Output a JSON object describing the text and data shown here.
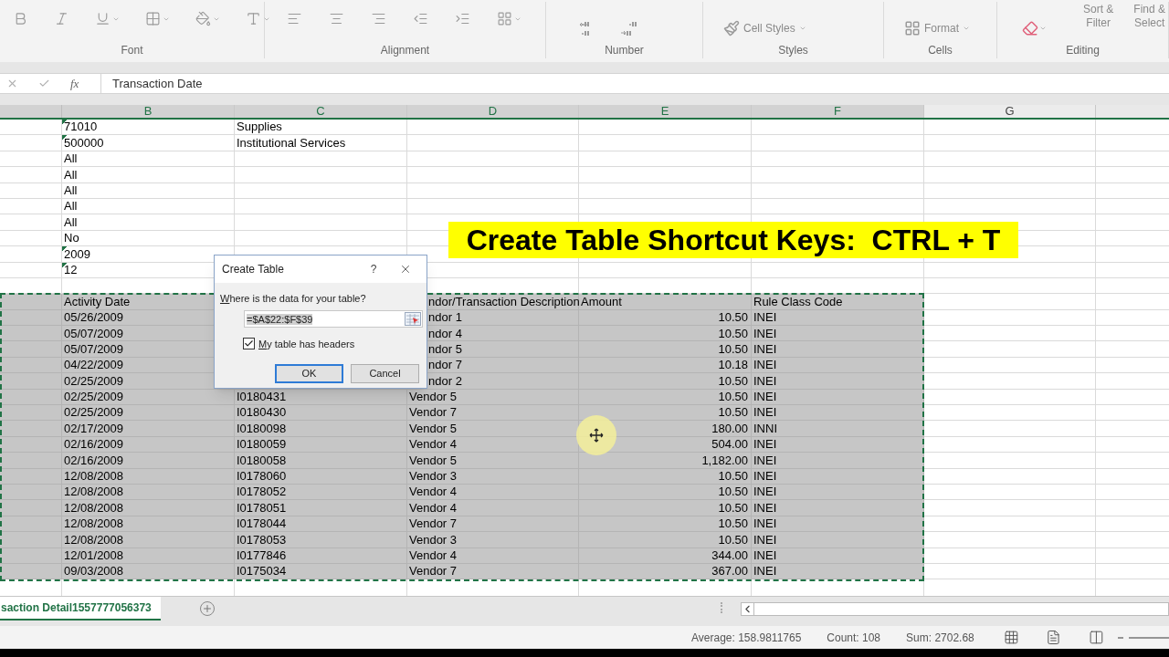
{
  "ribbon": {
    "groups": [
      {
        "label": "Font"
      },
      {
        "label": "Alignment"
      },
      {
        "label": "Number"
      },
      {
        "label": "Styles",
        "items": [
          "Cell Styles"
        ]
      },
      {
        "label": "Cells",
        "items": [
          "Format"
        ]
      },
      {
        "label": "Editing",
        "items": [
          "Sort &",
          "Filter",
          "Find &",
          "Select"
        ]
      }
    ]
  },
  "formula_bar": {
    "fx": "fx",
    "value": "Transaction Date"
  },
  "columns": [
    {
      "label": "B",
      "selected": true
    },
    {
      "label": "C",
      "selected": true
    },
    {
      "label": "D",
      "selected": true
    },
    {
      "label": "E",
      "selected": true
    },
    {
      "label": "F",
      "selected": true
    },
    {
      "label": "G",
      "selected": false
    }
  ],
  "top_rows": [
    {
      "value": "71010",
      "flagged": true,
      "description": "Supplies"
    },
    {
      "value": "500000",
      "flagged": true,
      "description": "Institutional Services"
    },
    {
      "value": "All",
      "flagged": false
    },
    {
      "value": "All",
      "flagged": false
    },
    {
      "value": "All",
      "flagged": false
    },
    {
      "value": "All",
      "flagged": false
    },
    {
      "value": "All",
      "flagged": false
    },
    {
      "value": "No",
      "flagged": false
    },
    {
      "value": "2009",
      "flagged": true
    },
    {
      "value": "12",
      "flagged": true
    }
  ],
  "table": {
    "header": {
      "date": "Activity Date",
      "vendor": "ndor/Transaction Description",
      "amount": "Amount",
      "code": "Rule Class Code",
      "covered": true
    },
    "rows": [
      {
        "date": "05/26/2009",
        "vendor": "ndor 1",
        "amount": "10.50",
        "code": "INEI",
        "covered": true
      },
      {
        "date": "05/07/2009",
        "vendor": "ndor 4",
        "amount": "10.50",
        "code": "INEI",
        "covered": true
      },
      {
        "date": "05/07/2009",
        "vendor": "ndor 5",
        "amount": "10.50",
        "code": "INEI",
        "covered": true
      },
      {
        "date": "04/22/2009",
        "vendor": "ndor 7",
        "amount": "10.18",
        "code": "INEI",
        "covered": true
      },
      {
        "date": "02/25/2009",
        "vendor": "ndor 2",
        "amount": "10.50",
        "code": "INEI",
        "covered": true
      },
      {
        "date": "02/25/2009",
        "id": "I0180431",
        "vendor": "Vendor 5",
        "amount": "10.50",
        "code": "INEI",
        "covered": false
      },
      {
        "date": "02/25/2009",
        "id": "I0180430",
        "vendor": "Vendor 7",
        "amount": "10.50",
        "code": "INEI",
        "covered": false
      },
      {
        "date": "02/17/2009",
        "id": "I0180098",
        "vendor": "Vendor 5",
        "amount": "180.00",
        "code": "INNI",
        "covered": false
      },
      {
        "date": "02/16/2009",
        "id": "I0180059",
        "vendor": "Vendor 4",
        "amount": "504.00",
        "code": "INEI",
        "covered": false
      },
      {
        "date": "02/16/2009",
        "id": "I0180058",
        "vendor": "Vendor 5",
        "amount": "1,182.00",
        "code": "INEI",
        "covered": false
      },
      {
        "date": "12/08/2008",
        "id": "I0178060",
        "vendor": "Vendor 3",
        "amount": "10.50",
        "code": "INEI",
        "covered": false
      },
      {
        "date": "12/08/2008",
        "id": "I0178052",
        "vendor": "Vendor 4",
        "amount": "10.50",
        "code": "INEI",
        "covered": false
      },
      {
        "date": "12/08/2008",
        "id": "I0178051",
        "vendor": "Vendor 4",
        "amount": "10.50",
        "code": "INEI",
        "covered": false
      },
      {
        "date": "12/08/2008",
        "id": "I0178044",
        "vendor": "Vendor 7",
        "amount": "10.50",
        "code": "INEI",
        "covered": false
      },
      {
        "date": "12/08/2008",
        "id": "I0178053",
        "vendor": "Vendor 3",
        "amount": "10.50",
        "code": "INEI",
        "covered": false
      },
      {
        "date": "12/01/2008",
        "id": "I0177846",
        "vendor": "Vendor 4",
        "amount": "344.00",
        "code": "INEI",
        "covered": false
      },
      {
        "date": "09/03/2008",
        "id": "I0175034",
        "vendor": "Vendor 7",
        "amount": "367.00",
        "code": "INEI",
        "covered": false
      }
    ]
  },
  "dialog": {
    "title": "Create Table",
    "help": "?",
    "prompt": "Where is the data for your table?",
    "range": "=$A$22:$F$39",
    "headers_label": "My table has headers",
    "headers_checked": true,
    "ok": "OK",
    "cancel": "Cancel"
  },
  "banner": {
    "text": "Create Table Shortcut Keys:  CTRL + T"
  },
  "sheet_tabs": [
    {
      "label": "saction Detail1557777056373",
      "selected": true
    }
  ],
  "status_bar": {
    "average": "Average: 158.9811765",
    "count": "Count: 108",
    "sum": "Sum: 2702.68"
  }
}
